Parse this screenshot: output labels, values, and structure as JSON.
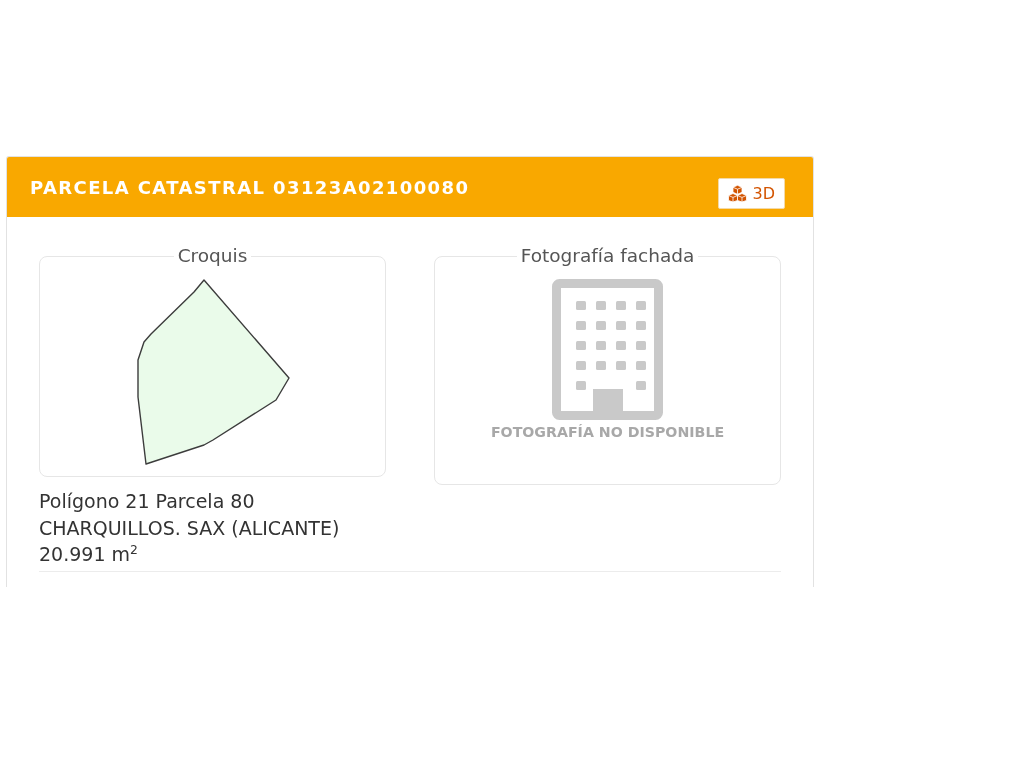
{
  "header": {
    "title": "PARCELA CATASTRAL 03123A02100080",
    "button": {
      "label": "3D"
    }
  },
  "sketch": {
    "legend": "Croquis"
  },
  "photo": {
    "legend": "Fotografía fachada",
    "unavailable_text": "FOTOGRAFÍA NO DISPONIBLE"
  },
  "details": [
    "Polígono 21 Parcela 80",
    "CHARQUILLOS. SAX (ALICANTE)",
    "20.991 m$^{2}$"
  ]
}
